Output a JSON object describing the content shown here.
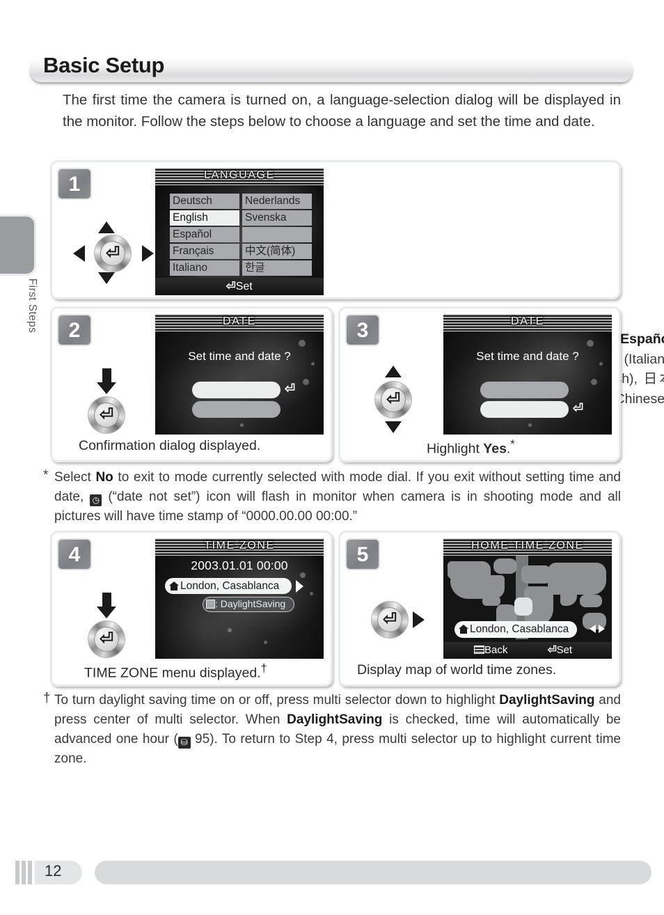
{
  "page": {
    "title": "Basic Setup",
    "sidebar_label": "First Steps",
    "page_number": "12",
    "intro": "The first time the camera is turned on, a language-selection dialog will be displayed in the monitor.  Follow the steps below to choose a language and set the time and date."
  },
  "steps": {
    "one": {
      "number": "1",
      "screen_title": "LANGUAGE",
      "languages": [
        "Deutsch",
        "Nederlands",
        "English",
        "Svenska",
        "Español",
        "",
        "Français",
        "中文(简体)",
        "Italiano",
        "한글"
      ],
      "selected_language": "English",
      "set_label": "Set",
      "return_glyph": "⏎",
      "instruction_html": "Highlight <b>Deutsch</b> (German), <b>English</b>, <b>Español</b> (Spanish), <b>Français</b> (French), <b>Italiano</b>, (Italian), <b>Nederlands</b> (Dutch), <b>Svenska</b> (Swedish), 日本語 (Japanese), <b>中文(简体)</b> (Simplified Chinese), or <b>한글</b> (Korean)."
    },
    "two": {
      "number": "2",
      "screen_title": "DATE",
      "question": "Set time and date ?",
      "caption_html": "Confirmation dialog displayed.",
      "highlighted_option": "yes",
      "return_glyph": "⏎"
    },
    "three": {
      "number": "3",
      "screen_title": "DATE",
      "question": "Set time and date ?",
      "caption_html": "Highlight <b>Yes</b>.<sup>*</sup>",
      "highlighted_option": "no",
      "return_glyph": "⏎"
    },
    "four": {
      "number": "4",
      "screen_title": "TIME ZONE",
      "datetime": "2003.01.01  00:00",
      "city": "London, Casablanca",
      "dst_label": ": DaylightSaving",
      "dst_checked": false,
      "caption_html": "TIME ZONE menu displayed.<sup>†</sup>"
    },
    "five": {
      "number": "5",
      "screen_title": "HOME TIME ZONE",
      "city": "London, Casablanca",
      "back_label": "Back",
      "set_label": "Set",
      "return_glyph": "⏎",
      "caption_html": "Display map of world time zones."
    }
  },
  "footnotes": {
    "asterisk_mark": "*",
    "asterisk_html": "Select <b>No</b> to exit to mode currently selected with mode dial.  If you exit without setting time and date, <span class=\"inline-icon-clock\">◷</span> (“date not set”) icon will flash in monitor when camera is in shooting mode and all pictures will have time stamp of  “0000.00.00 00:00.”",
    "dagger_mark": "†",
    "dagger_html": "To turn daylight saving time on or off, press multi selector down to highlight <b>DaylightSaving</b> and press center of multi selector.  When <b>DaylightSaving</b> is checked, time will automatically be advanced one hour (<span class=\"inline-icon-book\">⛁</span> 95).  To return to Step 4, press multi selector up to highlight current time zone."
  }
}
